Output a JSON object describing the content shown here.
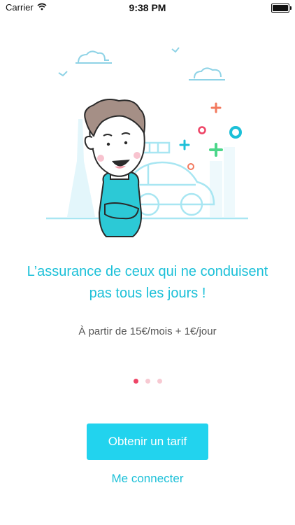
{
  "status_bar": {
    "carrier": "Carrier",
    "time": "9:38 PM"
  },
  "onboarding": {
    "headline": "L’assurance de ceux qui ne conduisent pas tous les jours !",
    "subline": "À partir de 15€/mois + 1€/jour",
    "page_index": 1,
    "page_count": 3
  },
  "actions": {
    "primary_label": "Obtenir un tarif",
    "secondary_label": "Me connecter"
  },
  "colors": {
    "accent": "#22d3ee",
    "accent_text": "#1cc0d8",
    "dot_active": "#ee4466",
    "dot_inactive": "#f7c9d2",
    "illustration_line": "#a8e6f2"
  },
  "icons": {
    "wifi": "wifi-icon",
    "battery": "battery-icon"
  }
}
